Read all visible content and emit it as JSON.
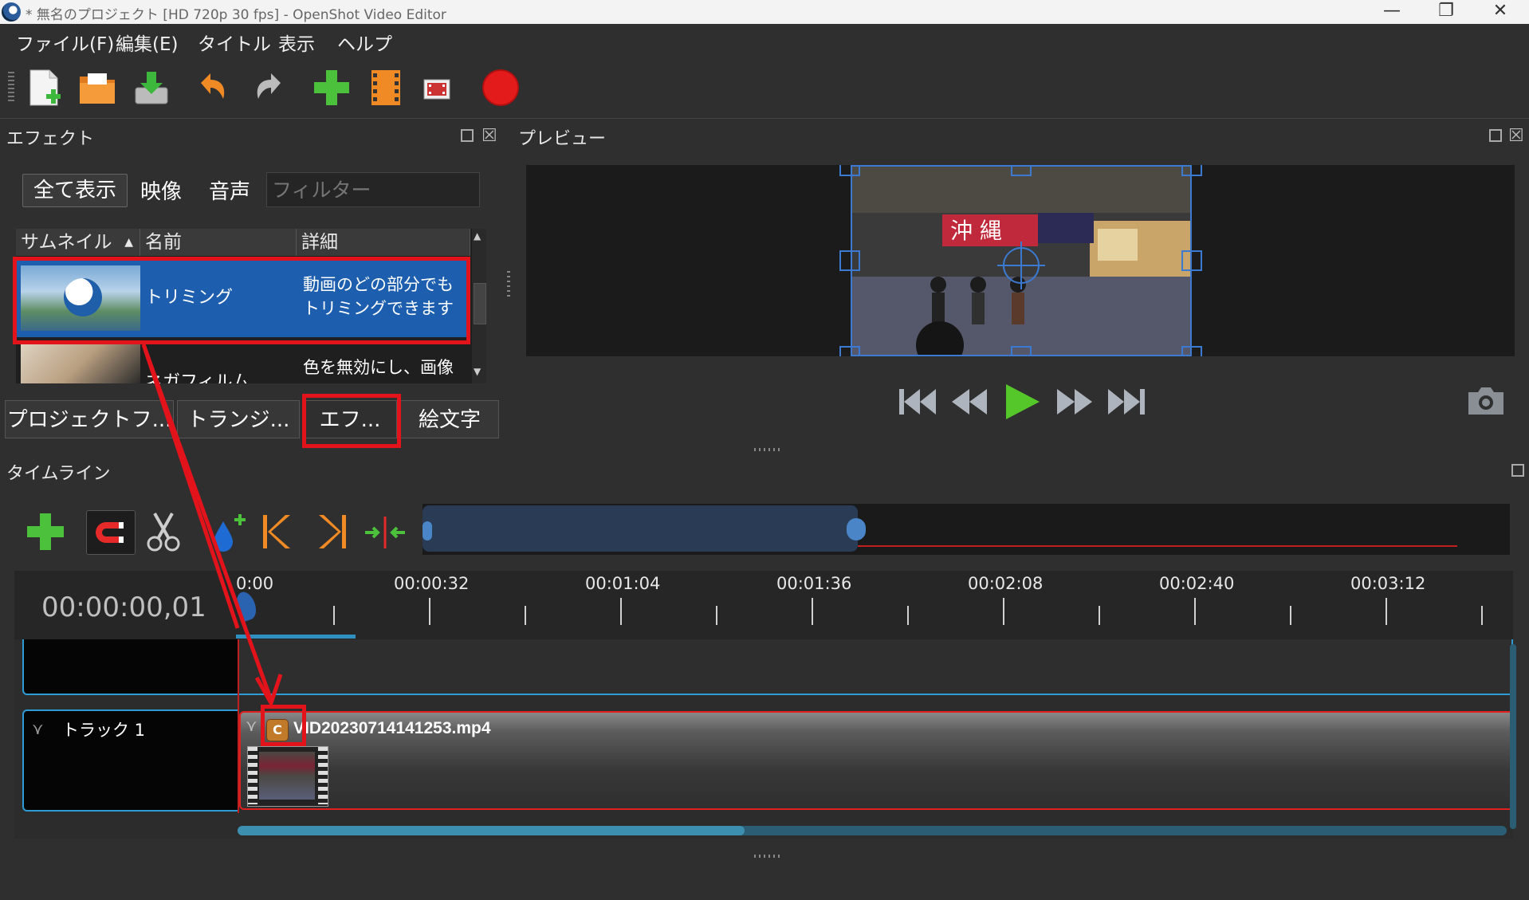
{
  "window": {
    "title": "* 無名のプロジェクト [HD 720p 30 fps] - OpenShot Video Editor",
    "minimize": "—",
    "maximize": "❐",
    "close": "✕"
  },
  "menu": [
    "ファイル(F)",
    "編集(E)",
    "タイトル",
    "表示",
    "ヘルプ"
  ],
  "toolbar": {
    "icons": [
      "new-project-icon",
      "open-project-icon",
      "save-project-icon",
      "undo-icon",
      "redo-icon",
      "import-files-icon",
      "profile-icon",
      "fullscreen-icon",
      "export-video-icon"
    ]
  },
  "effects": {
    "title": "エフェクト",
    "tabs": {
      "all": "全て表示",
      "video": "映像",
      "audio": "音声"
    },
    "filter_placeholder": "フィルター",
    "columns": {
      "thumbnail": "サムネイル",
      "name": "名前",
      "details": "詳細"
    },
    "rows": [
      {
        "name": "トリミング",
        "details_line1": "動画のどの部分でも",
        "details_line2": "トリミングできます"
      },
      {
        "name": "ネガフィルム",
        "details_line1": "色を無効にし、画像"
      }
    ]
  },
  "dock_tabs": [
    "プロジェクトフ...",
    "トランジ...",
    "エフ...",
    "絵文字"
  ],
  "preview": {
    "title": "プレビュー"
  },
  "timeline": {
    "title": "タイムライン",
    "current_time": "00:00:00,01",
    "ticks": [
      "0:00",
      "00:00:32",
      "00:01:04",
      "00:01:36",
      "00:02:08",
      "00:02:40",
      "00:03:12"
    ],
    "track_name": "トラック 1",
    "clip_name": "VID20230714141253.mp4",
    "clip_badge": "C"
  },
  "colors": {
    "accent": "#1d5fae",
    "annotation": "#e3131b",
    "track_border": "#2f9bd4"
  }
}
